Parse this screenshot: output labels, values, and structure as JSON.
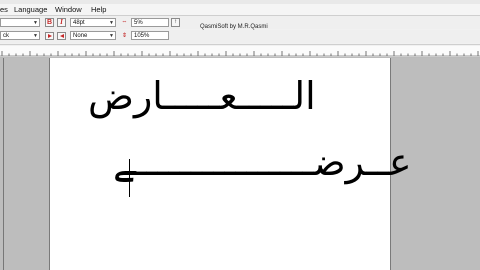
{
  "menu": {
    "items": [
      "es",
      "Language",
      "Window",
      "Help"
    ]
  },
  "toolbar1": {
    "font_combo": "",
    "bold_label": "B",
    "italic_label": "I",
    "size_combo": "48pt",
    "spacing_value": "5%",
    "credit": "QasmiSoft by M.R.Qasmi"
  },
  "toolbar2": {
    "style_combo": "ck",
    "border_combo": "None",
    "zoom_value": "105%"
  },
  "document": {
    "line1": "الـــــعـــــارض",
    "line2": "عــرضــــــــــــــــے"
  }
}
